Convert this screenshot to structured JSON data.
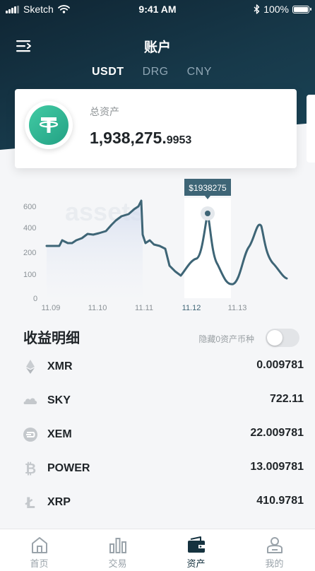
{
  "status_bar": {
    "carrier": "Sketch",
    "time": "9:41 AM",
    "battery": "100%",
    "battery_level": 1.0
  },
  "header": {
    "title": "账户",
    "menu_icon": "menu-icon"
  },
  "currency_tabs": [
    {
      "label": "USDT",
      "active": true
    },
    {
      "label": "DRG",
      "active": false
    },
    {
      "label": "CNY",
      "active": false
    }
  ],
  "asset_card": {
    "label": "总资产",
    "value_main": "1,938,275.",
    "value_decimal": "9953",
    "icon": "tether-icon",
    "icon_color": "#2ebc95"
  },
  "chart_data": {
    "type": "area",
    "x_ticks": [
      "11.09",
      "11.10",
      "11.11",
      "11.12",
      "11.13"
    ],
    "y_ticks": [
      "600",
      "400",
      "200",
      "100",
      "0"
    ],
    "tooltip": "$1938275",
    "line_color": "#3e6576",
    "highlight_tick": "11.12",
    "watermark": "assets"
  },
  "income": {
    "title": "收益明细",
    "hide_zero_label": "隐藏0资产币种",
    "hide_zero_enabled": false,
    "items": [
      {
        "name": "XMR",
        "amount": "0.009781",
        "icon": "ethereum-icon"
      },
      {
        "name": "SKY",
        "amount": "722.11",
        "icon": "cloud-icon"
      },
      {
        "name": "XEM",
        "amount": "22.009781",
        "icon": "dash-icon"
      },
      {
        "name": "POWER",
        "amount": "13.009781",
        "icon": "bitcoin-icon"
      },
      {
        "name": "XRP",
        "amount": "410.9781",
        "icon": "litecoin-icon"
      }
    ]
  },
  "tab_bar": [
    {
      "label": "首页",
      "icon": "home-icon",
      "active": false
    },
    {
      "label": "交易",
      "icon": "bar-chart-icon",
      "active": false
    },
    {
      "label": "资产",
      "icon": "wallet-icon",
      "active": true
    },
    {
      "label": "我的",
      "icon": "user-icon",
      "active": false
    }
  ]
}
